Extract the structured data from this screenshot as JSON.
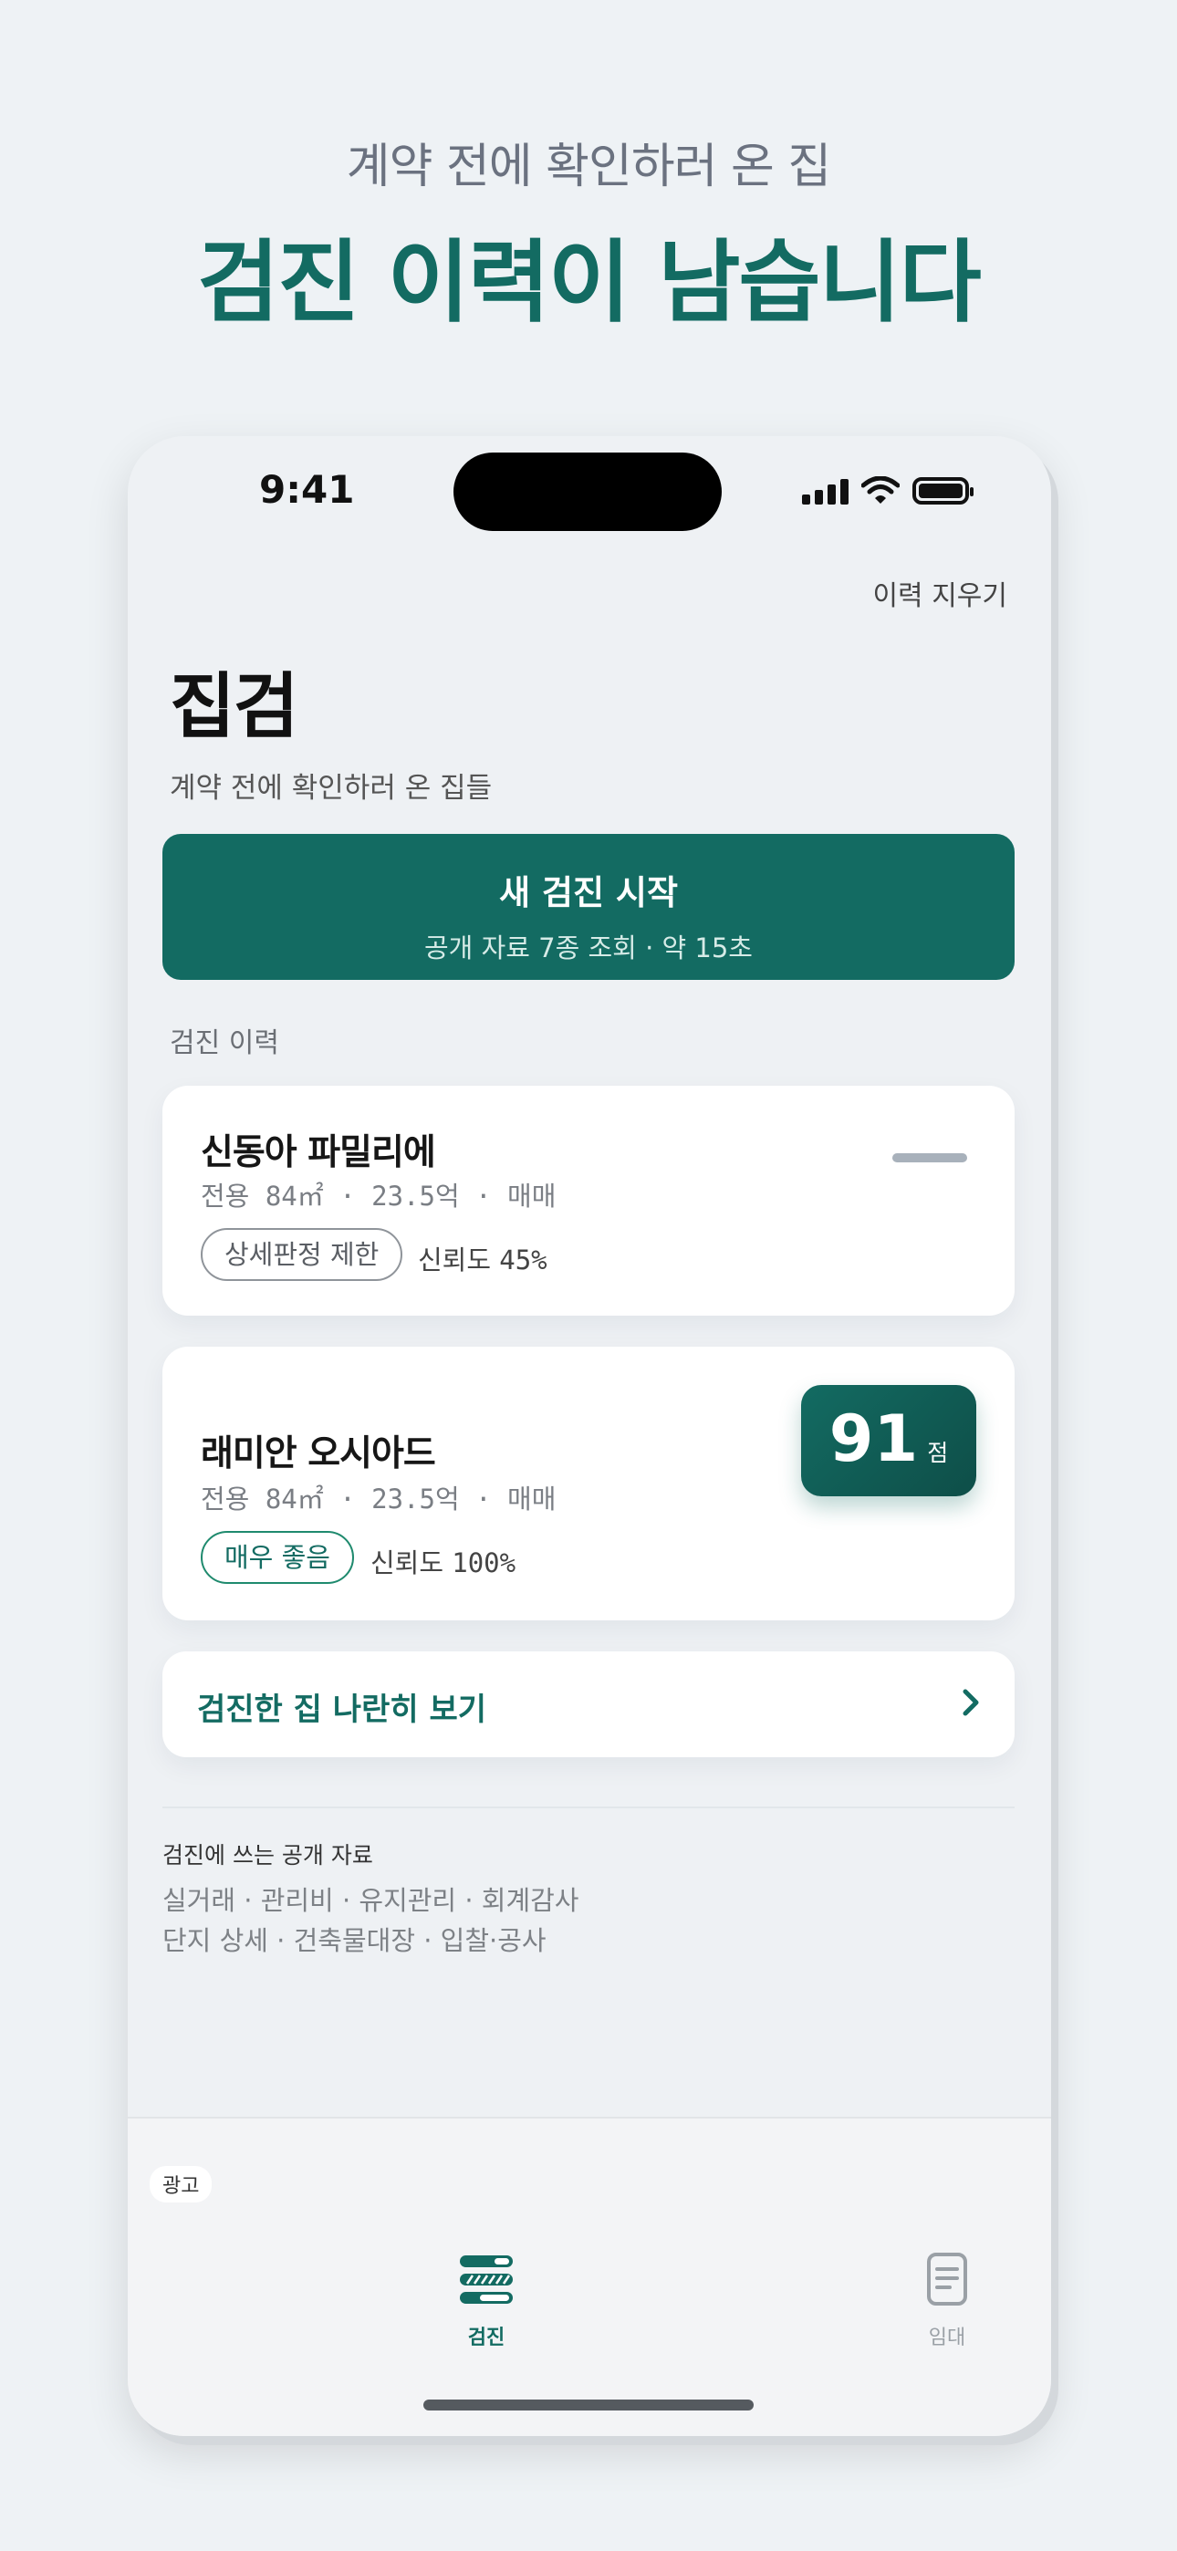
{
  "promo": {
    "subtitle": "계약 전에 확인하러 온 집",
    "title": "검진 이력이 남습니다"
  },
  "status_bar": {
    "time": "9:41"
  },
  "header": {
    "clear_history": "이력 지우기",
    "app_title": "집검",
    "app_subtitle": "계약 전에 확인하러 온 집들"
  },
  "start_button": {
    "title": "새 검진 시작",
    "meta": "공개 자료 7종 조회 · 약 15초"
  },
  "history": {
    "section_label": "검진 이력",
    "items": [
      {
        "name": "신동아 파밀리에",
        "meta": "전용 84㎡ · 23.5억 · 매매",
        "badge": "상세판정 제한",
        "reliability_label": "신뢰도",
        "reliability_value": "45%",
        "score": null
      },
      {
        "name": "래미안 오시아드",
        "meta": "전용 84㎡ · 23.5억 · 매매",
        "badge": "매우 좋음",
        "reliability_label": "신뢰도",
        "reliability_value": "100%",
        "score": "91",
        "score_unit": "점"
      }
    ]
  },
  "compare": {
    "label": "검진한 집 나란히 보기"
  },
  "sources": {
    "heading": "검진에 쓰는 공개 자료",
    "line1": "실거래 · 관리비 · 유지관리 · 회계감사",
    "line2": "단지 상세 · 건축물대장 · 입찰·공사"
  },
  "tabbar": {
    "ad_label": "광고",
    "tabs": [
      {
        "label": "검진",
        "icon": "checkup-icon",
        "active": true
      },
      {
        "label": "임대",
        "icon": "document-icon",
        "active": false
      }
    ]
  },
  "colors": {
    "brand": "#136b62",
    "background": "#eef2f5",
    "card": "#ffffff"
  }
}
